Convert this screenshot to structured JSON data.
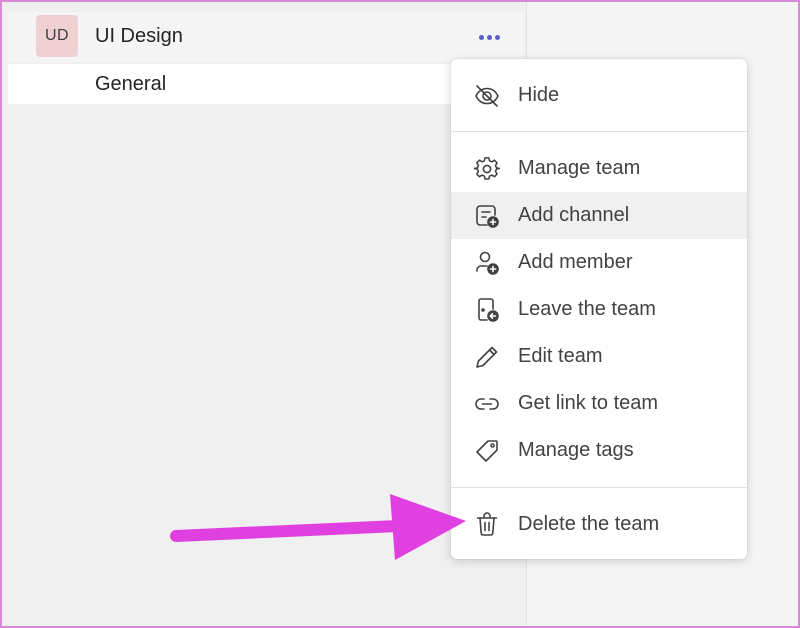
{
  "team": {
    "avatar_initials": "UD",
    "name": "UI Design",
    "more_icon": "more-horizontal-icon"
  },
  "channel": {
    "name": "General"
  },
  "menu": {
    "items": [
      {
        "label": "Hide",
        "icon": "eye-off-icon"
      },
      {
        "label": "Manage team",
        "icon": "gear-icon"
      },
      {
        "label": "Add channel",
        "icon": "add-channel-icon",
        "highlighted": true
      },
      {
        "label": "Add member",
        "icon": "add-person-icon"
      },
      {
        "label": "Leave the team",
        "icon": "leave-door-icon"
      },
      {
        "label": "Edit team",
        "icon": "pencil-icon"
      },
      {
        "label": "Get link to team",
        "icon": "link-icon"
      },
      {
        "label": "Manage tags",
        "icon": "tag-icon"
      },
      {
        "label": "Delete the team",
        "icon": "trash-icon"
      }
    ]
  },
  "annotation": {
    "arrow_color": "#e040e0",
    "points_to": "Delete the team"
  },
  "colors": {
    "accent": "#5b5fc7",
    "avatar_bg": "#efd0d3",
    "frame": "#d98ad6",
    "highlight": "#f0f0f0"
  }
}
